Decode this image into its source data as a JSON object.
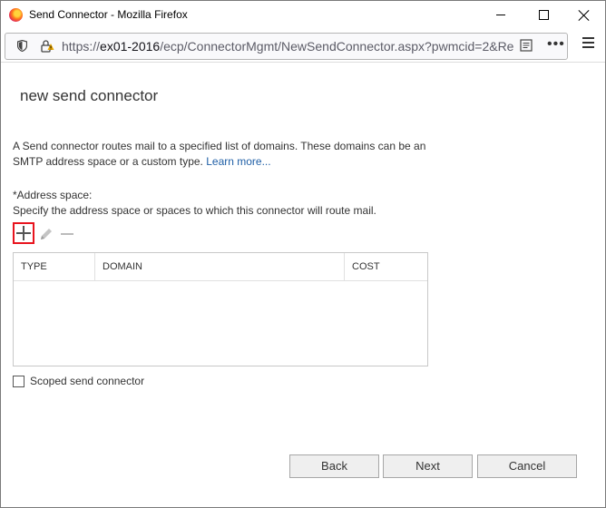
{
  "window": {
    "title": "Send Connector - Mozilla Firefox",
    "url_prefix": "https://",
    "url_host": "ex01-2016",
    "url_path": "/ecp/ConnectorMgmt/NewSendConnector.aspx?pwmcid=2&Re",
    "menu_glyph": "•••"
  },
  "page": {
    "heading": "new send connector",
    "description": "A Send connector routes mail to a specified list of domains. These domains can be an SMTP address space or a custom type.",
    "learn_more": "Learn more...",
    "address_label": "*Address space:",
    "address_help": "Specify the address space or spaces to which this connector will route mail."
  },
  "grid": {
    "columns": [
      "TYPE",
      "DOMAIN",
      "COST"
    ],
    "rows": []
  },
  "scoped_label": "Scoped send connector",
  "buttons": {
    "back": "Back",
    "next": "Next",
    "cancel": "Cancel"
  },
  "colors": {
    "highlight": "#e8141e",
    "link": "#1f5fa6"
  }
}
